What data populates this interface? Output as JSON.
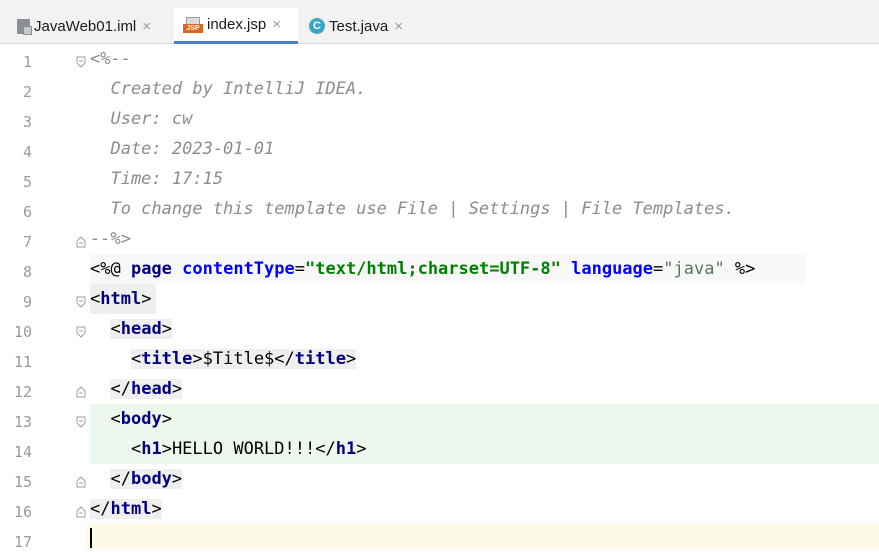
{
  "tabs": [
    {
      "label": "JavaWeb01.iml",
      "icon": "module-file-icon",
      "close": "×",
      "active": false
    },
    {
      "label": "index.jsp",
      "icon": "jsp-file-icon",
      "icon_text": "JSP",
      "close": "×",
      "active": true
    },
    {
      "label": "Test.java",
      "icon": "java-class-icon",
      "icon_text": "C",
      "close": "×",
      "active": false
    }
  ],
  "line_numbers": [
    "1",
    "2",
    "3",
    "4",
    "5",
    "6",
    "7",
    "8",
    "9",
    "10",
    "11",
    "12",
    "13",
    "14",
    "15",
    "16",
    "17"
  ],
  "code": {
    "l1": "<%--",
    "l2": "  Created by IntelliJ IDEA.",
    "l3": "  User: cw",
    "l4": "  Date: 2023-01-01",
    "l5": "  Time: 17:15",
    "l6": "  To change this template use File | Settings | File Templates.",
    "l7": "--%>",
    "l8": {
      "open": "<%@ ",
      "directive": "page",
      "attr1": "contentType",
      "eq1": "=",
      "val1": "\"text/html;charset=UTF-8\"",
      "attr2": "language",
      "eq2": "=",
      "val2": "\"java\"",
      "close": " %>"
    },
    "l9": {
      "lt": "<",
      "tag": "html",
      "gt": ">"
    },
    "l10": {
      "indent": "  ",
      "lt": "<",
      "tag": "head",
      "gt": ">"
    },
    "l11": {
      "indent": "    ",
      "lt": "<",
      "tag": "title",
      "gt": ">",
      "text": "$Title$",
      "lt2": "</",
      "tag2": "title",
      "gt2": ">"
    },
    "l12": {
      "indent": "  ",
      "lt": "</",
      "tag": "head",
      "gt": ">"
    },
    "l13": {
      "indent": "  ",
      "lt": "<",
      "tag": "body",
      "gt": ">"
    },
    "l14": {
      "indent": "    ",
      "lt": "<",
      "tag": "h1",
      "gt": ">",
      "text": "HELLO WORLD!!!",
      "lt2": "</",
      "tag2": "h1",
      "gt2": ">"
    },
    "l15": {
      "indent": "  ",
      "lt": "</",
      "tag": "body",
      "gt": ">"
    },
    "l16": {
      "lt": "</",
      "tag": "html",
      "gt": ">"
    },
    "l17": ""
  },
  "colors": {
    "tab_underline": "#4a7dc8",
    "body_highlight": "#edf7ed",
    "current_line": "#fdfbe6",
    "tag_bg": "#efefef"
  }
}
